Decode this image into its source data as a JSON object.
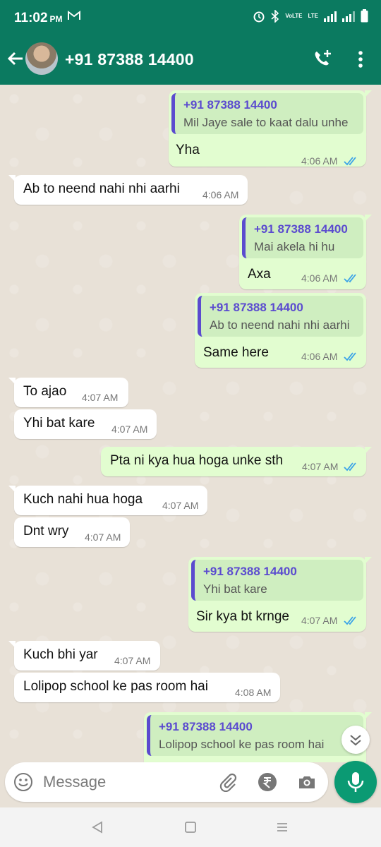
{
  "status_bar": {
    "time": "11:02",
    "ampm": "PM",
    "notification_icon": "gmail-icon",
    "network_label": "LTE",
    "volte_label": "VoLTE"
  },
  "header": {
    "contact_name": "+91 87388 14400",
    "icons": [
      "back-arrow-icon",
      "avatar",
      "add-call-icon",
      "more-vert-icon"
    ]
  },
  "colors": {
    "header": "#0b7a60",
    "outgoing_bubble": "#e2fdd0",
    "incoming_bubble": "#ffffff",
    "quote_accent": "#5b4bcf",
    "read_ticks": "#3aa3e8",
    "mic_button": "#0b9a73"
  },
  "messages": [
    {
      "dir": "out",
      "quote_name": "+91 87388 14400",
      "quote_text": "Mil Jaye sale to kaat dalu unhe",
      "text": "Yha",
      "time": "4:06 AM",
      "read": true
    },
    {
      "dir": "in",
      "text": "Ab to neend nahi nhi aarhi",
      "time": "4:06 AM"
    },
    {
      "dir": "out",
      "quote_name": "+91 87388 14400",
      "quote_text": "Mai akela hi hu",
      "text": "Axa",
      "time": "4:06 AM",
      "read": true
    },
    {
      "dir": "out",
      "quote_name": "+91 87388 14400",
      "quote_text": "Ab to neend nahi nhi aarhi",
      "text": "Same here",
      "time": "4:06 AM",
      "read": true
    },
    {
      "dir": "in",
      "text": "To ajao",
      "time": "4:07 AM"
    },
    {
      "dir": "in",
      "text": "Yhi bat kare",
      "time": "4:07 AM"
    },
    {
      "dir": "out",
      "text": "Pta ni kya hua hoga unke sth",
      "time": "4:07 AM",
      "read": true
    },
    {
      "dir": "in",
      "text": "Kuch nahi hua hoga",
      "time": "4:07 AM"
    },
    {
      "dir": "in",
      "text": "Dnt wry",
      "time": "4:07 AM"
    },
    {
      "dir": "out",
      "quote_name": "+91 87388 14400",
      "quote_text": "Yhi bat kare",
      "text": "Sir kya bt krnge",
      "time": "4:07 AM",
      "read": true
    },
    {
      "dir": "in",
      "text": "Kuch bhi yar",
      "time": "4:07 AM"
    },
    {
      "dir": "in",
      "text": "Lolipop school ke pas room hai",
      "time": "4:08 AM"
    },
    {
      "dir": "out",
      "quote_name": "+91 87388 14400",
      "quote_text": "Lolipop school ke pas room hai",
      "text": "",
      "time": "",
      "read": true
    }
  ],
  "composer": {
    "placeholder": "Message",
    "icons": [
      "emoji-icon",
      "attach-icon",
      "rupee-icon",
      "camera-icon",
      "mic-icon"
    ]
  },
  "nav": {
    "icons": [
      "nav-back-icon",
      "nav-home-icon",
      "nav-recents-icon"
    ]
  }
}
